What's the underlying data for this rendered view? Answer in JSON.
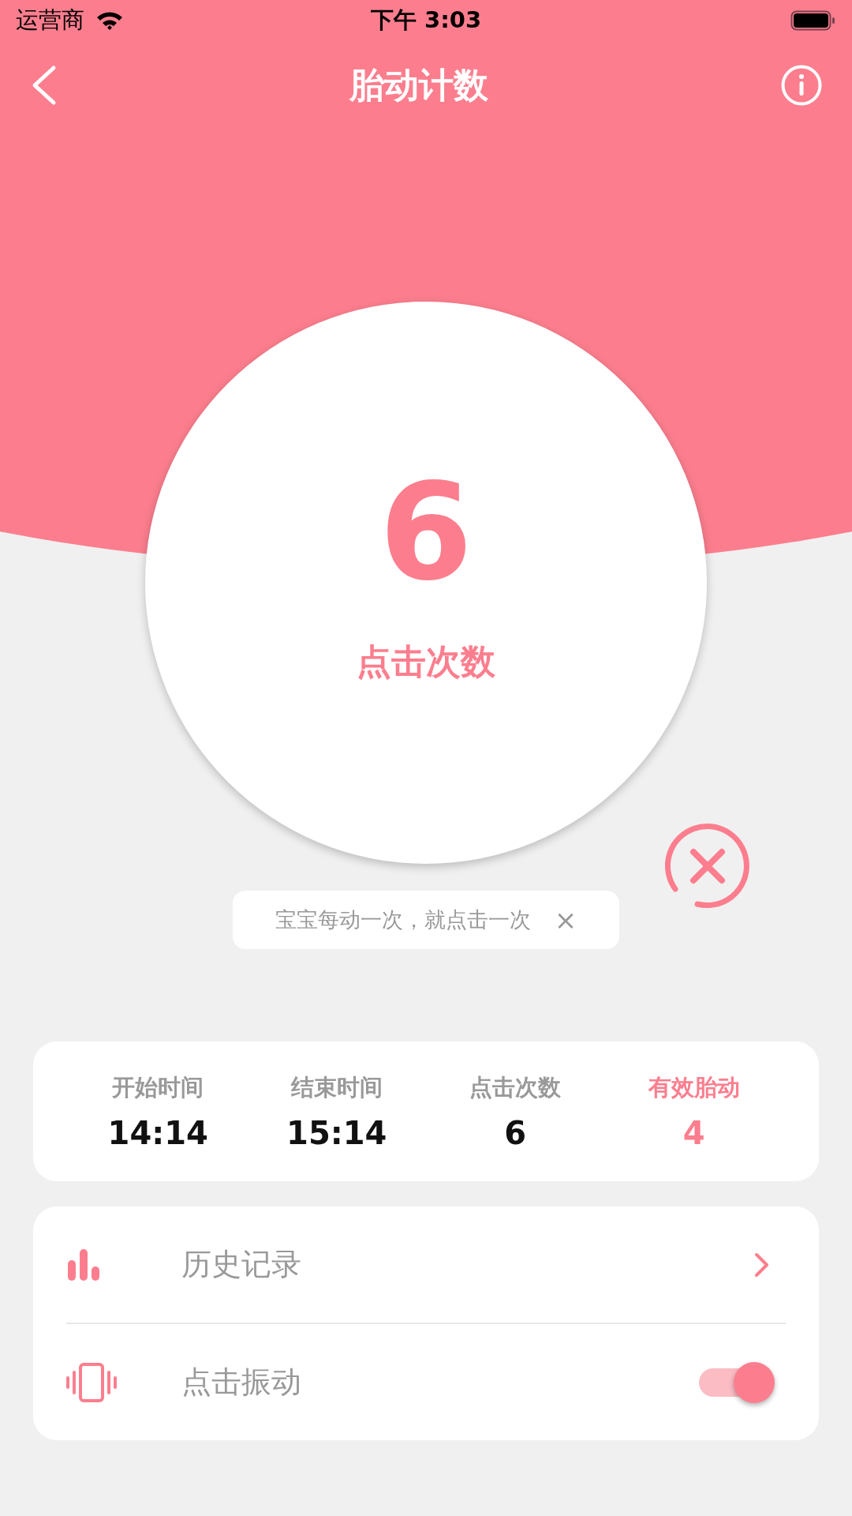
{
  "status_bar": {
    "carrier": "运营商",
    "time": "下午 3:03"
  },
  "nav": {
    "title": "胎动计数"
  },
  "counter": {
    "count": "6",
    "label": "点击次数"
  },
  "tip": {
    "text": "宝宝每动一次，就点击一次",
    "close": "×"
  },
  "stats": [
    {
      "label": "开始时间",
      "value": "14:14",
      "highlight": false
    },
    {
      "label": "结束时间",
      "value": "15:14",
      "highlight": false
    },
    {
      "label": "点击次数",
      "value": "6",
      "highlight": false
    },
    {
      "label": "有效胎动",
      "value": "4",
      "highlight": true
    }
  ],
  "menu": [
    {
      "kind": "link",
      "label": "历史记录"
    },
    {
      "kind": "toggle",
      "label": "点击振动",
      "on": true
    }
  ]
}
